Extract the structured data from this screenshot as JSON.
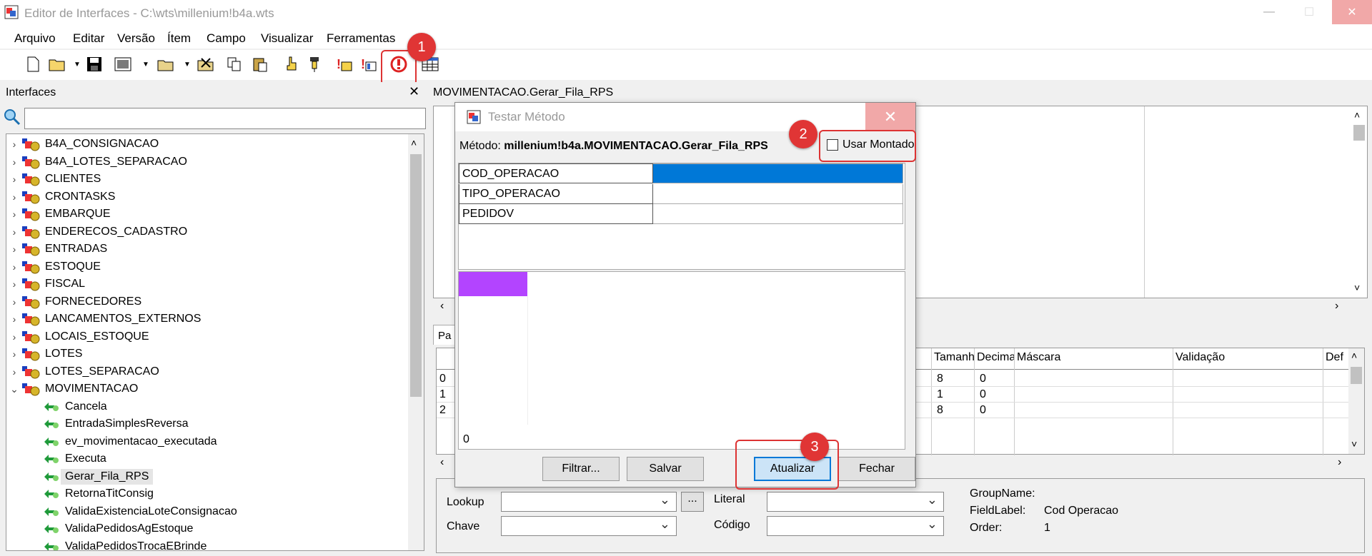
{
  "window": {
    "title": "Editor de Interfaces - C:\\wts\\millenium!b4a.wts",
    "min_label": "—",
    "max_label": "☐",
    "close_label": "✕"
  },
  "menu": [
    "Arquivo",
    "Editar",
    "Versão",
    "Ítem",
    "Campo",
    "Visualizar",
    "Ferramentas"
  ],
  "badges": {
    "b1": "1",
    "b2": "2",
    "b3": "3"
  },
  "left_panel": {
    "title": "Interfaces",
    "close_label": "✕",
    "search_value": "",
    "tree": [
      {
        "label": "B4A_CONSIGNACAO",
        "expanded": false
      },
      {
        "label": "B4A_LOTES_SEPARACAO",
        "expanded": false
      },
      {
        "label": "CLIENTES",
        "expanded": false
      },
      {
        "label": "CRONTASKS",
        "expanded": false
      },
      {
        "label": "EMBARQUE",
        "expanded": false
      },
      {
        "label": "ENDERECOS_CADASTRO",
        "expanded": false
      },
      {
        "label": "ENTRADAS",
        "expanded": false
      },
      {
        "label": "ESTOQUE",
        "expanded": false
      },
      {
        "label": "FISCAL",
        "expanded": false
      },
      {
        "label": "FORNECEDORES",
        "expanded": false
      },
      {
        "label": "LANCAMENTOS_EXTERNOS",
        "expanded": false
      },
      {
        "label": "LOCAIS_ESTOQUE",
        "expanded": false
      },
      {
        "label": "LOTES",
        "expanded": false
      },
      {
        "label": "LOTES_SEPARACAO",
        "expanded": false
      },
      {
        "label": "MOVIMENTACAO",
        "expanded": true
      }
    ],
    "methods": [
      "Cancela",
      "EntradaSimplesReversa",
      "ev_movimentacao_executada",
      "Executa",
      "Gerar_Fila_RPS",
      "RetornaTitConsig",
      "ValidaExistenciaLoteConsignacao",
      "ValidaPedidosAgEstoque",
      "ValidaPedidosTrocaEBrinde"
    ],
    "selected_method": "Gerar_Fila_RPS"
  },
  "right_panel": {
    "title": "MOVIMENTACAO.Gerar_Fila_RPS",
    "tab_label": "Pa",
    "grid_headers": [
      "Tamanh",
      "Decima",
      "Máscara",
      "Validação",
      "Def"
    ],
    "grid_rows": [
      {
        "idx": "0",
        "tam": "8",
        "dec": "0"
      },
      {
        "idx": "1",
        "tam": "1",
        "dec": "0"
      },
      {
        "idx": "2",
        "tam": "8",
        "dec": "0"
      }
    ],
    "props": {
      "lookup_label": "Lookup",
      "lookup_value": "",
      "ellipsis": "...",
      "chave_label": "Chave",
      "chave_value": "",
      "literal_label": "Literal",
      "literal_value": "",
      "codigo_label": "Código",
      "codigo_value": "",
      "groupname_label": "GroupName:",
      "groupname_value": "",
      "fieldlabel_label": "FieldLabel:",
      "fieldlabel_value": "Cod Operacao",
      "order_label": "Order:",
      "order_value": "1"
    }
  },
  "dialog": {
    "title": "Testar Método",
    "close_label": "✕",
    "method_prefix": "Método:",
    "method_value": "millenium!b4a.MOVIMENTACAO.Gerar_Fila_RPS",
    "usar_montado": "Usar Montado",
    "usar_montado_checked": false,
    "params": [
      {
        "name": "COD_OPERACAO",
        "value": ""
      },
      {
        "name": "TIPO_OPERACAO",
        "value": ""
      },
      {
        "name": "PEDIDOV",
        "value": ""
      }
    ],
    "result_count": "0",
    "buttons": {
      "filtrar": "Filtrar...",
      "salvar": "Salvar",
      "atualizar": "Atualizar",
      "fechar": "Fechar"
    }
  },
  "colors": {
    "selection": "#0078d7",
    "highlight_red": "#d33333",
    "swatch_purple": "#b344ff",
    "atualizar_bg": "#cce4f7"
  }
}
